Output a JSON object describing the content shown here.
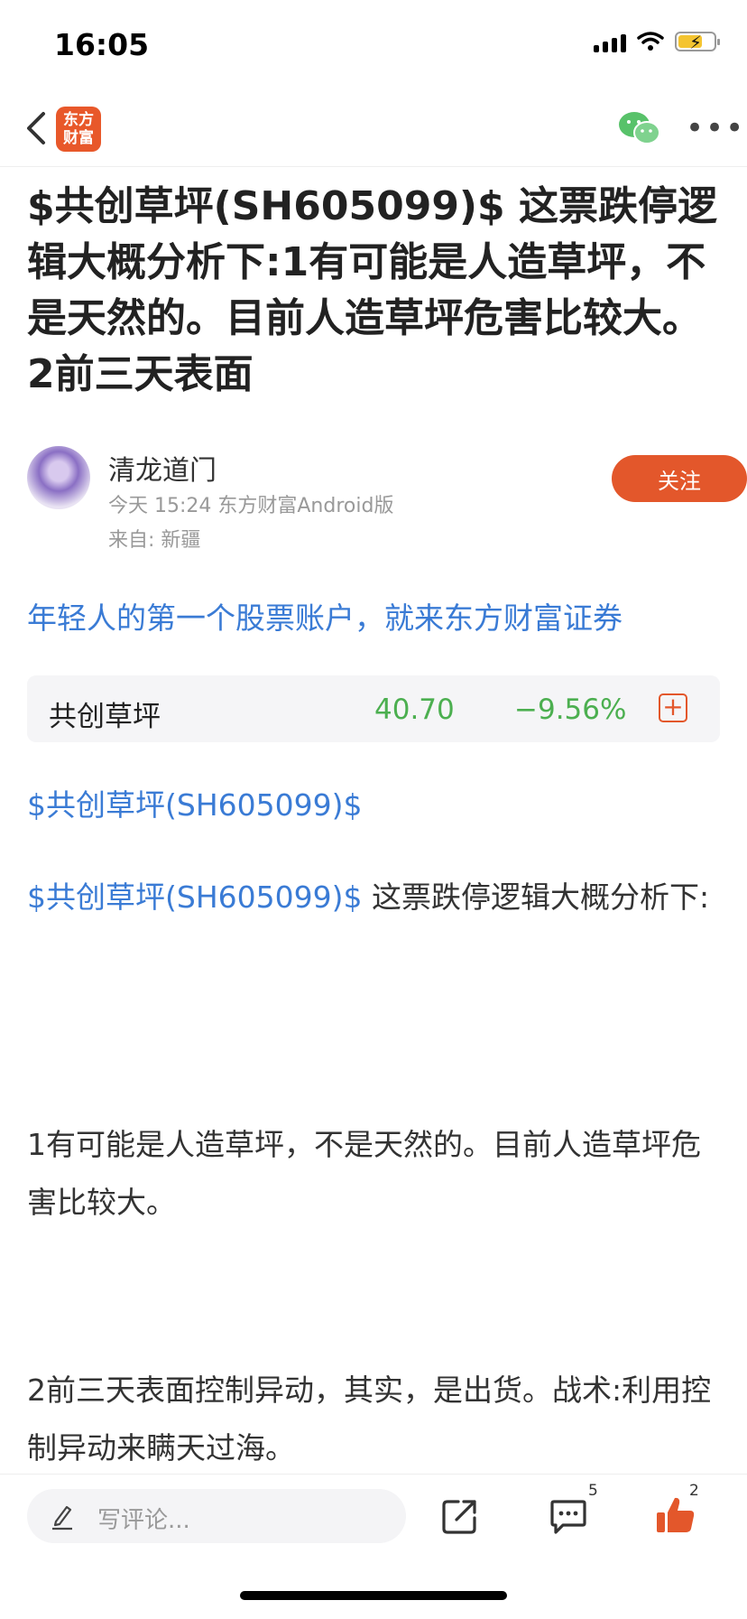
{
  "status": {
    "time": "16:05"
  },
  "nav": {
    "logo_line1": "东方",
    "logo_line2": "财富"
  },
  "article": {
    "title": "$共创草坪(SH605099)$ 这票跌停逻辑大概分析下:1有可能是人造草坪，不是天然的。目前人造草坪危害比较大。2前三天表面"
  },
  "author": {
    "name": "清龙道门",
    "meta": "今天 15:24 东方财富Android版",
    "location": "来自: 新疆",
    "follow_label": "关注"
  },
  "ad": {
    "text": "年轻人的第一个股票账户，就来东方财富证券"
  },
  "stock": {
    "name": "共创草坪",
    "price": "40.70",
    "change": "−9.56%",
    "add_icon": "plus-square-icon"
  },
  "content": {
    "p1_link": "$共创草坪(SH605099)$",
    "p2_link": "$共创草坪(SH605099)$",
    "p2_text": " 这票跌停逻辑大概分析下:",
    "p3_text": "1有可能是人造草坪，不是天然的。目前人造草坪危害比较大。",
    "p4_text": "2前三天表面控制异动，其实，是出货。战术:利用控制异动来瞒天过海。"
  },
  "bottom": {
    "comment_placeholder": "写评论...",
    "comment_count": "5",
    "like_count": "2"
  },
  "colors": {
    "accent": "#e3572b",
    "link": "#3a7bd5",
    "down": "#4caf50"
  }
}
